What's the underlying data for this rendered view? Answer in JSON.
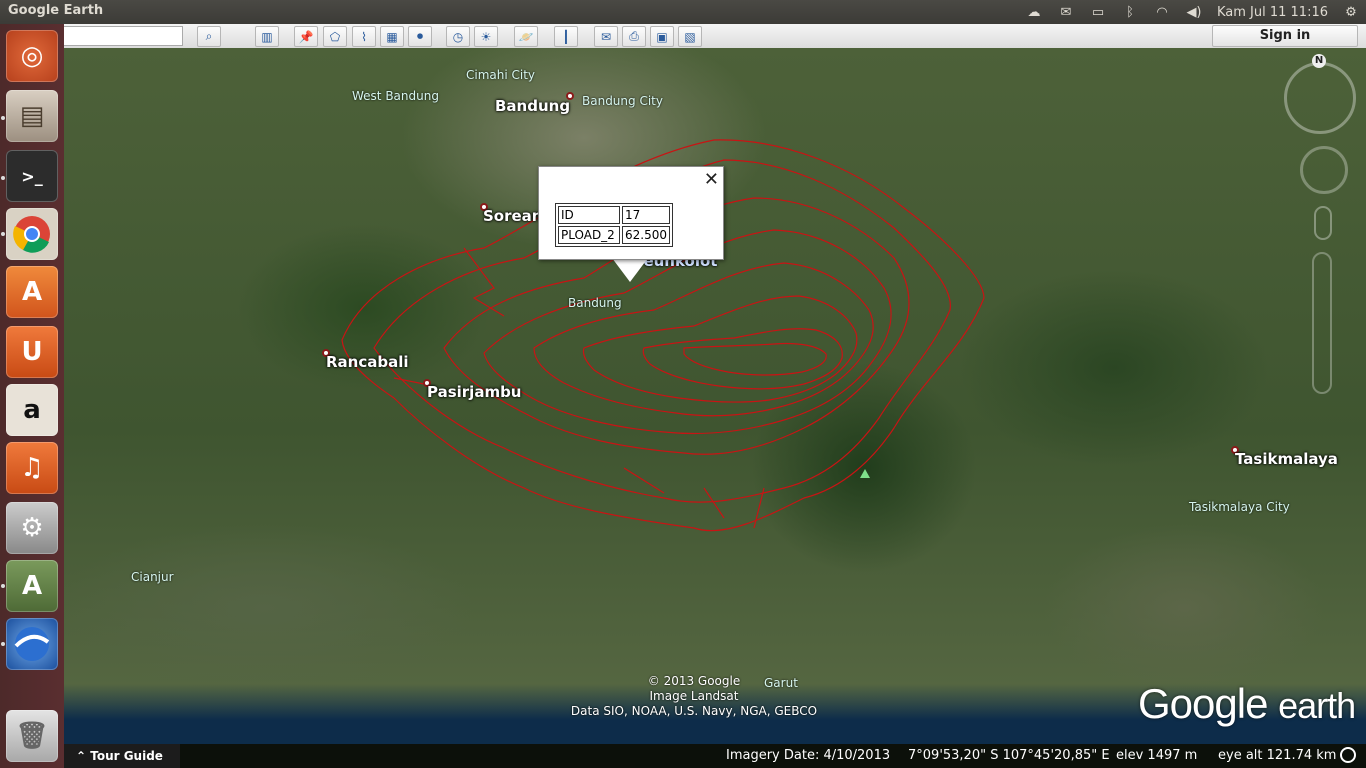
{
  "panel": {
    "app_title": "Google Earth",
    "clock": "Kam Jul 11  11:16"
  },
  "toolbar": {
    "signin_label": "Sign in"
  },
  "map": {
    "places": [
      "Bandung",
      "Sorean",
      "Rancabali",
      "Pasirjambu",
      "Tasikmalaya",
      "Soreang"
    ],
    "cities": [
      "Cimahi City",
      "Bandung City",
      "West Bandung",
      "Bandung",
      "Tasikmalaya City",
      "Cianjur",
      "Garut"
    ],
    "balloon_partial_label": "ayeuhkolot"
  },
  "balloon": {
    "close_glyph": "✕",
    "rows": [
      {
        "key": "ID",
        "value": "17"
      },
      {
        "key": "PLOAD_2",
        "value": "62.500"
      }
    ]
  },
  "attribution": {
    "line1": "© 2013 Google",
    "line2": "Image Landsat",
    "line3": "Data SIO, NOAA, U.S. Navy, NGA, GEBCO"
  },
  "logo": {
    "google": "Google",
    "earth": "earth"
  },
  "compass": {
    "north": "N"
  },
  "status": {
    "tour_guide": "Tour Guide",
    "imagery_date": "Imagery Date: 4/10/2013",
    "coords": "7°09'53,20\" S  107°45'20,85\" E",
    "elev": "elev  1497 m",
    "eye_alt": "eye alt 121.74 km"
  },
  "icons": {
    "toolbar": [
      "search-icon",
      "sidebar-icon",
      "placemark-icon",
      "polygon-icon",
      "path-icon",
      "overlay-icon",
      "tour-icon",
      "history-icon",
      "sun-icon",
      "planets-icon",
      "ruler-icon",
      "email-icon",
      "print-icon",
      "save-image-icon",
      "maps-icon"
    ]
  }
}
